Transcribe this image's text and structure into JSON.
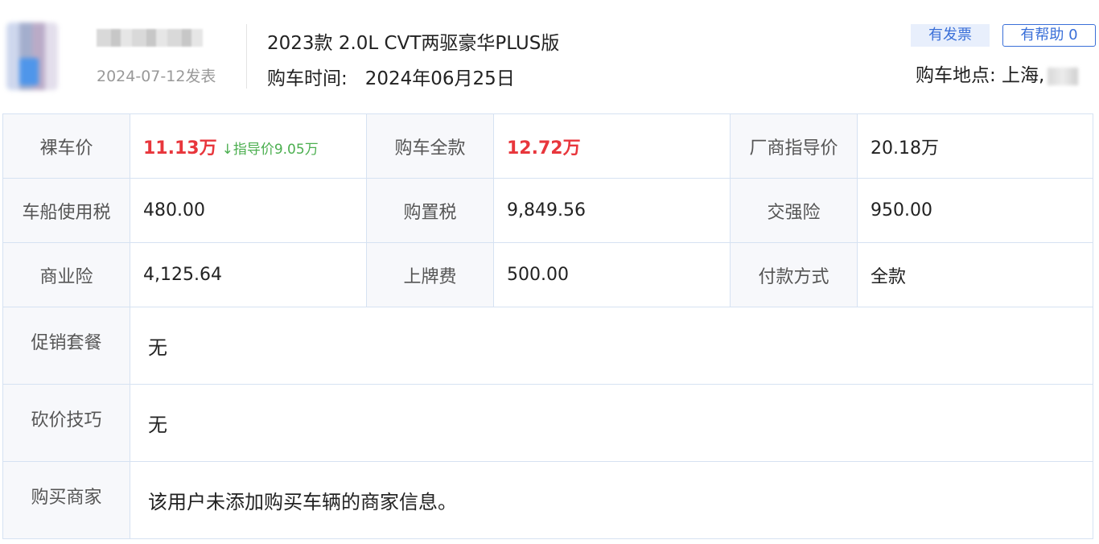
{
  "user": {
    "post_date": "2024-07-12发表"
  },
  "car": {
    "model": "2023款 2.0L CVT两驱豪华PLUS版",
    "buy_time_label": "购车时间:",
    "buy_time_value": "2024年06月25日",
    "location": "购车地点: 上海,"
  },
  "actions": {
    "invoice_badge": "有发票",
    "helpful_label": "有帮助 0"
  },
  "price_table": {
    "bare_price_label": "裸车价",
    "bare_price_value": "11.13万",
    "guide_note": "↓指导价9.05万",
    "total_label": "购车全款",
    "total_value": "12.72万",
    "msrp_label": "厂商指导价",
    "msrp_value": "20.18万",
    "vehicle_tax_label": "车船使用税",
    "vehicle_tax_value": "480.00",
    "purchase_tax_label": "购置税",
    "purchase_tax_value": "9,849.56",
    "compulsory_ins_label": "交强险",
    "compulsory_ins_value": "950.00",
    "commercial_ins_label": "商业险",
    "commercial_ins_value": "4,125.64",
    "plate_fee_label": "上牌费",
    "plate_fee_value": "500.00",
    "payment_label": "付款方式",
    "payment_value": "全款",
    "promo_label": "促销套餐",
    "promo_value": "无",
    "bargain_label": "砍价技巧",
    "bargain_value": "无",
    "dealer_label": "购买商家",
    "dealer_value": "该用户未添加购买车辆的商家信息。"
  },
  "colors": {
    "price_red": "#e8363c",
    "guide_green": "#4caf50",
    "accent_blue": "#3a6fd8",
    "border": "#d6e2f2"
  }
}
